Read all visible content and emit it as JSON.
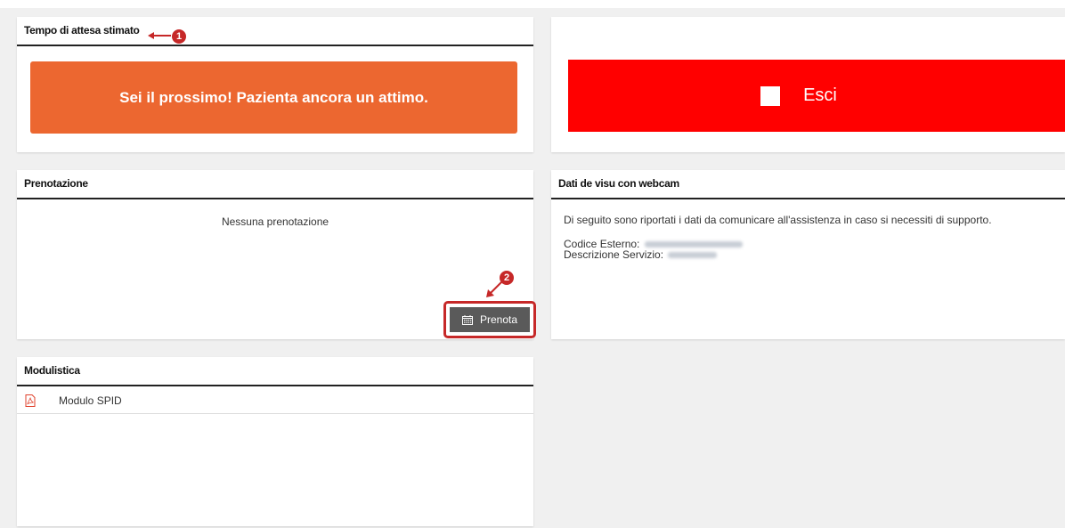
{
  "wait_panel": {
    "title": "Tempo di attesa stimato",
    "message": "Sei il prossimo! Pazienta ancora un attimo.",
    "color": "#ec6730"
  },
  "exit_panel": {
    "button_label": "Esci",
    "color": "#ff0000"
  },
  "booking_panel": {
    "title": "Prenotazione",
    "empty_text": "Nessuna prenotazione",
    "book_button_label": "Prenota"
  },
  "webcam_panel": {
    "title": "Dati de visu con webcam",
    "intro": "Di seguito sono riportati i dati da comunicare all'assistenza in caso si necessiti di supporto.",
    "external_code_label": "Codice Esterno:",
    "service_description_label": "Descrizione Servizio:"
  },
  "forms_panel": {
    "title": "Modulistica",
    "items": [
      {
        "label": "Modulo SPID",
        "icon": "pdf-icon"
      }
    ]
  },
  "annotations": [
    {
      "number": "1"
    },
    {
      "number": "2"
    }
  ],
  "accent_color": "#c62828"
}
